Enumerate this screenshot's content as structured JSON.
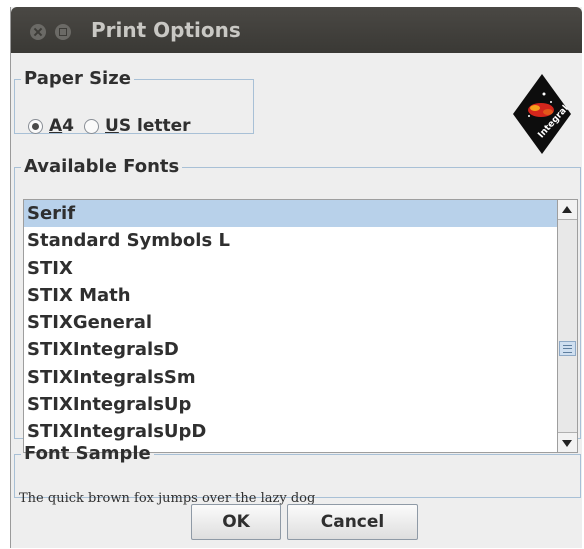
{
  "window": {
    "title": "Print Options"
  },
  "paper_size": {
    "legend": "Paper Size",
    "options": [
      {
        "mnemonic": "A",
        "rest": "4",
        "checked": true
      },
      {
        "mnemonic": "U",
        "rest": "S letter",
        "checked": false
      }
    ]
  },
  "logo": {
    "label": "Integral",
    "icon": "integral-logo-icon"
  },
  "fonts": {
    "legend": "Available Fonts",
    "items": [
      "Serif",
      "Standard Symbols L",
      "STIX",
      "STIX Math",
      "STIXGeneral",
      "STIXIntegralsD",
      "STIXIntegralsSm",
      "STIXIntegralsUp",
      "STIXIntegralsUpD"
    ],
    "selected": "Serif"
  },
  "sample": {
    "legend": "Font Sample",
    "text": "The quick brown fox jumps over the lazy dog"
  },
  "buttons": {
    "ok": "OK",
    "cancel": "Cancel"
  },
  "colors": {
    "titlebar": "#3d3c38",
    "selection": "#b8d1ea",
    "border_accent": "#a8c0d6"
  }
}
